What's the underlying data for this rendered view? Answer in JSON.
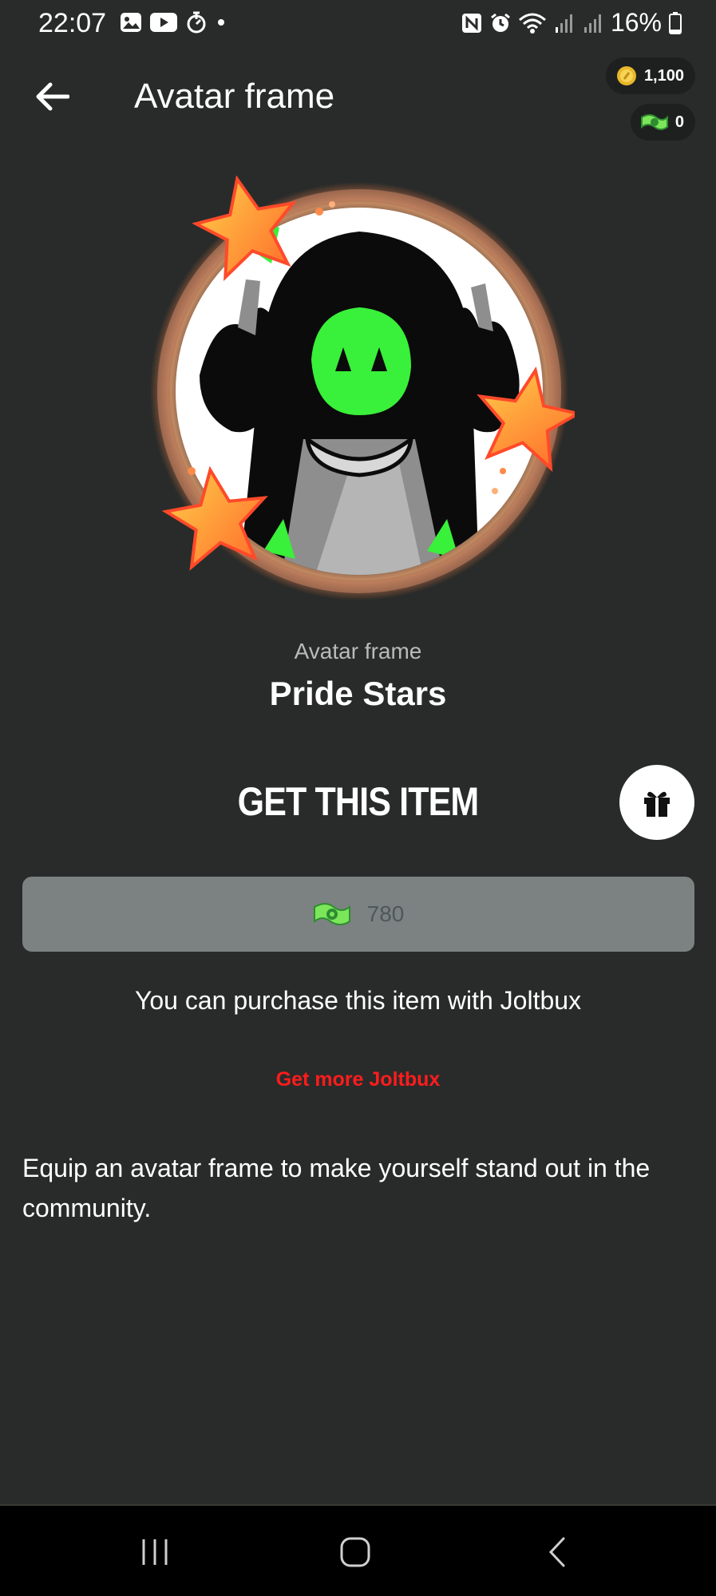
{
  "status_bar": {
    "time": "22:07",
    "battery": "16%",
    "left_icons": [
      "gallery-icon",
      "youtube-icon",
      "timer-app-icon",
      "dot-icon"
    ],
    "right_icons": [
      "nfc-icon",
      "alarm-icon",
      "wifi-icon",
      "signal-icon",
      "signal-icon",
      "battery-icon"
    ]
  },
  "header": {
    "back_icon": "arrow-left-icon",
    "title": "Avatar frame",
    "coins": "1,100",
    "joltbux": "0"
  },
  "item": {
    "type_label": "Avatar frame",
    "name": "Pride Stars"
  },
  "purchase": {
    "heading": "GET THIS ITEM",
    "gift_icon": "gift-icon",
    "price": "780",
    "note": "You can purchase this item with Joltbux",
    "get_more_link": "Get more Joltbux"
  },
  "description": "Equip an avatar frame to make yourself stand out in the community.",
  "nav": {
    "recents_icon": "recents-icon",
    "home_icon": "home-icon",
    "back_icon": "back-chevron-icon"
  },
  "colors": {
    "background": "#292b2a",
    "price_button": "#7b8281",
    "link_red": "#ff1c1c",
    "avatar_green": "#39f03a"
  }
}
